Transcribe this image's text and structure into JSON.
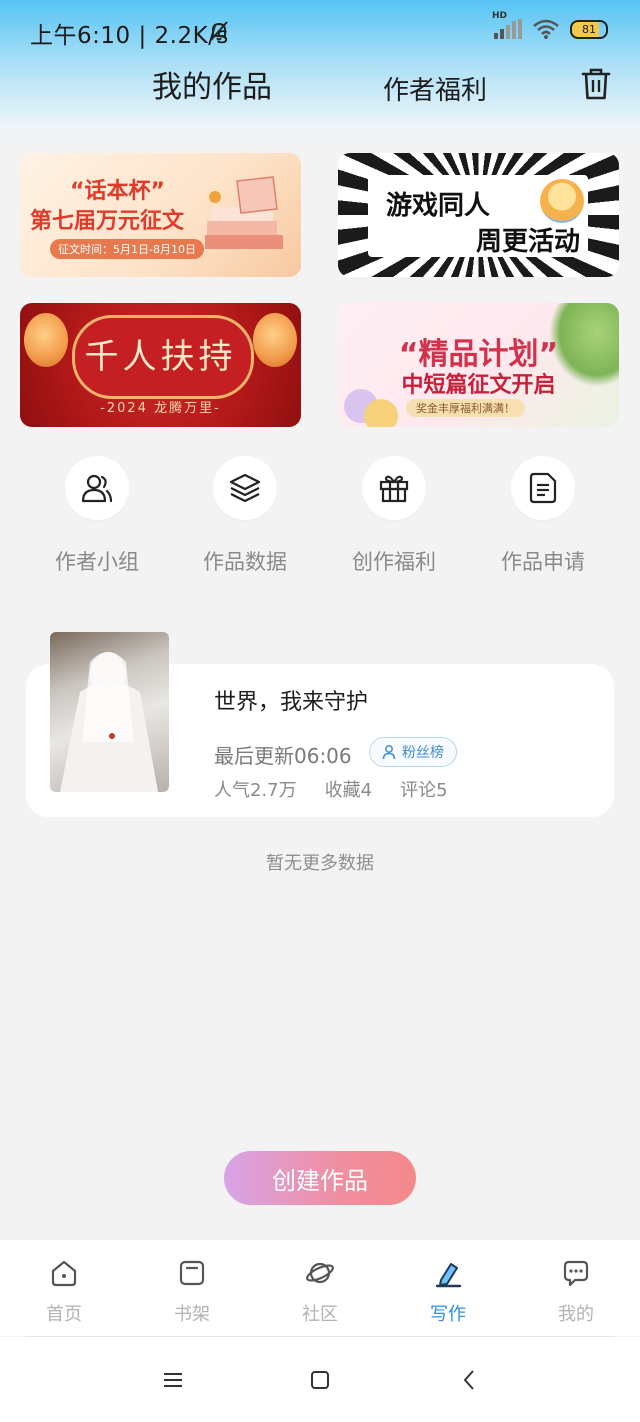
{
  "status_bar": {
    "text": "上午6:10 | 2.2K/s",
    "network": "HD",
    "battery": "81"
  },
  "header": {
    "title": "我的作品",
    "welfare_tab": "作者福利"
  },
  "banners": [
    {
      "line1": "“话本杯”",
      "line2": "第七届万元征文",
      "line3": "征文时间：5月1日-8月10日"
    },
    {
      "line1": "游戏同人",
      "line2": "周更活动"
    },
    {
      "line1": "千人扶持",
      "line2": "-2024 龙腾万里-"
    },
    {
      "line1": "“精品计划”",
      "line2": "中短篇征文开启",
      "line3": "奖金丰厚福利满满！"
    }
  ],
  "quick_actions": [
    {
      "label": "作者小组",
      "icon": "author-group-icon"
    },
    {
      "label": "作品数据",
      "icon": "layers-icon"
    },
    {
      "label": "创作福利",
      "icon": "gift-icon"
    },
    {
      "label": "作品申请",
      "icon": "document-icon"
    }
  ],
  "work": {
    "title": "世界，我来守护",
    "last_update": "最后更新06:06",
    "fans_badge": "粉丝榜",
    "popularity": "人气2.7万",
    "favorites": "收藏4",
    "comments": "评论5"
  },
  "empty_hint": "暂无更多数据",
  "create_button": "创建作品",
  "bottom_nav": [
    {
      "label": "首页",
      "icon": "home-icon",
      "active": false
    },
    {
      "label": "书架",
      "icon": "bookshelf-icon",
      "active": false
    },
    {
      "label": "社区",
      "icon": "planet-icon",
      "active": false
    },
    {
      "label": "写作",
      "icon": "pen-icon",
      "active": true
    },
    {
      "label": "我的",
      "icon": "chat-bubble-icon",
      "active": false
    }
  ],
  "colors": {
    "accent": "#2f8fe4",
    "create_gradient_start": "#d7a4e6",
    "create_gradient_end": "#f48a8a"
  }
}
